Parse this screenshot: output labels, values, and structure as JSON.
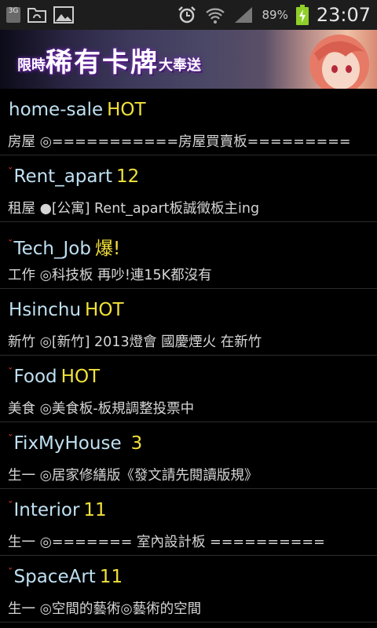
{
  "status_bar": {
    "network_badge": "3G",
    "battery_percent": "89%",
    "time": "23:07",
    "icons": [
      "3g-badge-icon",
      "file-icon",
      "image-icon",
      "alarm-icon",
      "wifi-icon",
      "signal-icon",
      "battery-charging-icon"
    ]
  },
  "banner": {
    "text_small_left": "限時",
    "text_main": "稀有卡牌",
    "text_small_right": "大奉送"
  },
  "boards": [
    {
      "name": "home-sale",
      "indicator": "HOT",
      "description": "房屋 ◎===========房屋買賣板=========",
      "marked": false
    },
    {
      "name": "Rent_apart",
      "indicator": "12",
      "description": "租屋 ●[公寓] Rent_apart板誠徵板主ing",
      "marked": true
    },
    {
      "name": "Tech_Job",
      "indicator": "爆!",
      "description": "工作 ◎科技板  再吵!連15K都沒有",
      "marked": true
    },
    {
      "name": "Hsinchu",
      "indicator": "HOT",
      "description": "新竹 ◎[新竹] 2013燈會 國慶煙火 在新竹",
      "marked": false
    },
    {
      "name": "Food",
      "indicator": "HOT",
      "description": "美食 ◎美食板-板規調整投票中",
      "marked": true
    },
    {
      "name": "FixMyHouse",
      "indicator": "3",
      "description": "生一 ◎居家修繕版《發文請先閱讀版規》",
      "marked": true
    },
    {
      "name": "Interior",
      "indicator": "11",
      "description": "生一 ◎=======  室內設計板  ==========",
      "marked": true
    },
    {
      "name": "SpaceArt",
      "indicator": "11",
      "description": "生一 ◎空間的藝術◎藝術的空間",
      "marked": true
    }
  ],
  "colors": {
    "board_name": "#bfe0f2",
    "indicator": "#f2e23a",
    "mark": "#e23a2a",
    "background": "#000000"
  }
}
